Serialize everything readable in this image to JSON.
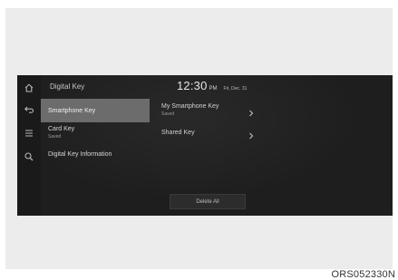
{
  "header": {
    "title": "Digital Key",
    "clock_time": "12:30",
    "clock_ampm": "PM",
    "clock_date": "Fri, Dec. 31"
  },
  "rail": {
    "icons": [
      "home-icon",
      "back-icon",
      "menu-icon",
      "search-icon"
    ]
  },
  "menu": {
    "items": [
      {
        "label": "Smartphone Key",
        "sub": ""
      },
      {
        "label": "Card Key",
        "sub": "Saved"
      },
      {
        "label": "Digital Key Information",
        "sub": ""
      }
    ]
  },
  "detail": {
    "rows": [
      {
        "label": "My Smartphone Key",
        "sub": "Saved"
      },
      {
        "label": "Shared Key",
        "sub": ""
      }
    ]
  },
  "actions": {
    "delete_all_label": "Delete All"
  },
  "figure": {
    "code": "ORS052330N"
  },
  "colors": {
    "screen_bg": "#1e1e1e",
    "active_item_bg": "#6c6c6c",
    "frame_bg": "#ececec"
  }
}
